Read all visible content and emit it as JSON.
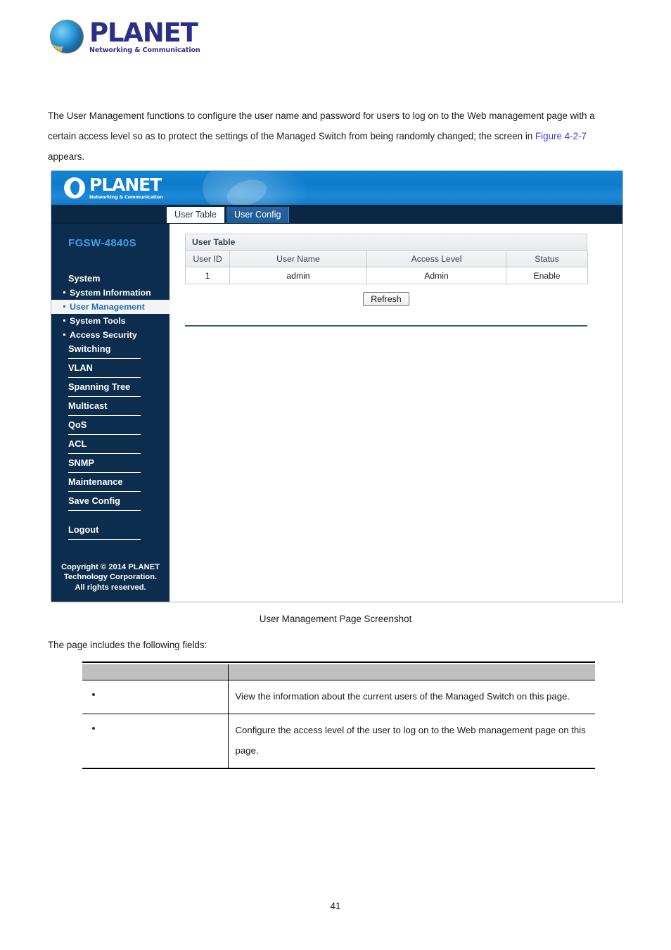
{
  "document": {
    "logo": {
      "word": "PLANET",
      "tagline": "Networking & Communication"
    },
    "paragraph_1_part1": "The User Management functions to configure the user name and password for users to log on to the Web management page with a certain access level so as to protect the settings of the Managed Switch from being randomly changed; the screen in ",
    "figure_link": "Figure 4-2-7",
    "paragraph_1_part2": " appears.",
    "caption": "User Management Page Screenshot",
    "paragraph_2": "The page includes the following fields:",
    "page_number": "41"
  },
  "screenshot": {
    "banner": {
      "logo_word": "PLANET",
      "logo_tagline": "Networking & Communication"
    },
    "model": "FGSW-4840S",
    "tabs": [
      {
        "label": "User Table",
        "active": true
      },
      {
        "label": "User Config",
        "active": false
      }
    ],
    "sidebar": {
      "items": [
        {
          "label": "System",
          "type": "group",
          "rule": false
        },
        {
          "label": "System Information",
          "type": "sub",
          "selected": false
        },
        {
          "label": "User Management",
          "type": "sub",
          "selected": true
        },
        {
          "label": "System Tools",
          "type": "sub",
          "selected": false
        },
        {
          "label": "Access Security",
          "type": "sub",
          "selected": false
        },
        {
          "label": "Switching",
          "type": "group",
          "rule": true
        },
        {
          "label": "VLAN",
          "type": "group",
          "rule": true
        },
        {
          "label": "Spanning Tree",
          "type": "group",
          "rule": true
        },
        {
          "label": "Multicast",
          "type": "group",
          "rule": true
        },
        {
          "label": "QoS",
          "type": "group",
          "rule": true
        },
        {
          "label": "ACL",
          "type": "group",
          "rule": true
        },
        {
          "label": "SNMP",
          "type": "group",
          "rule": true
        },
        {
          "label": "Maintenance",
          "type": "group",
          "rule": true
        },
        {
          "label": "Save Config",
          "type": "group",
          "rule": true
        },
        {
          "label": "Logout",
          "type": "group",
          "rule": true,
          "spacer_before": true
        }
      ],
      "copyright": "Copyright © 2014 PLANET Technology Corporation. All rights reserved."
    },
    "panel": {
      "title": "User Table",
      "columns": [
        "User ID",
        "User Name",
        "Access Level",
        "Status"
      ],
      "rows": [
        {
          "user_id": "1",
          "user_name": "admin",
          "access_level": "Admin",
          "status": "Enable"
        }
      ],
      "refresh_label": "Refresh"
    }
  },
  "fields_table": {
    "headers": [
      "",
      ""
    ],
    "rows": [
      {
        "label": "",
        "description": "View the information about the current users of the Managed Switch on this page."
      },
      {
        "label": "",
        "description": "Configure the access level of the user to log on to the Web management page on this page."
      }
    ]
  },
  "colors": {
    "brand_blue": "#2c2f86",
    "ui_banner_blue": "#1183d6",
    "sidebar_navy": "#0c2d4d",
    "selected_item_blue": "#1d6fb8",
    "link_blue": "#3b3bd4"
  }
}
